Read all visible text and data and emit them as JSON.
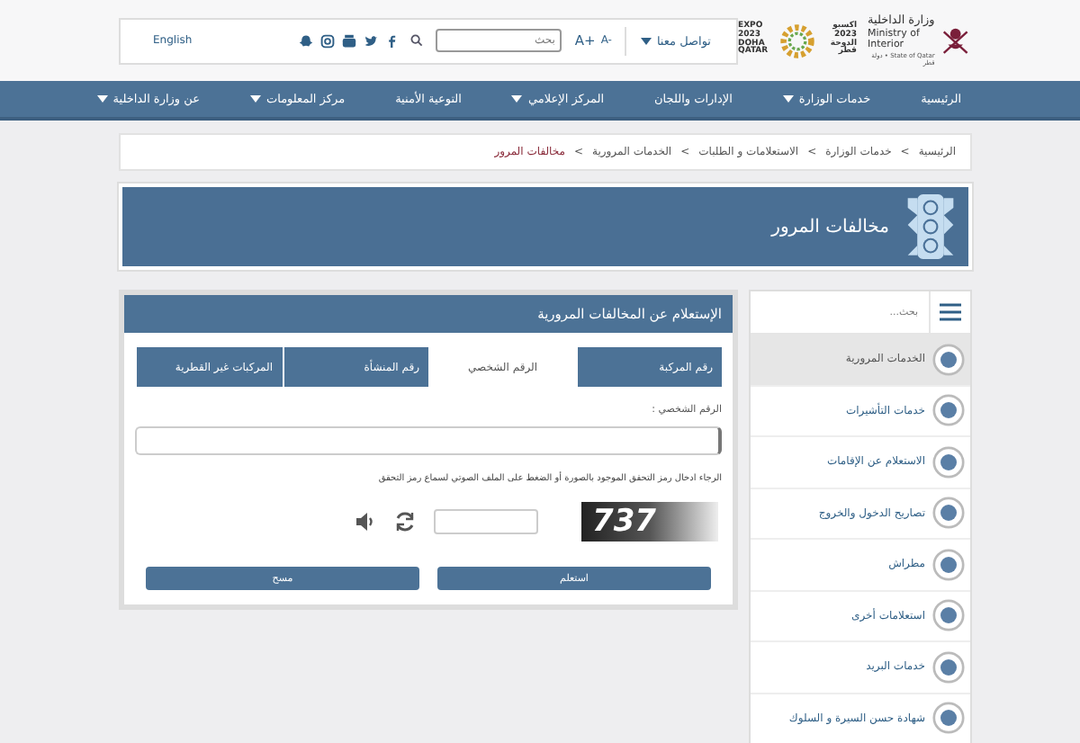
{
  "header": {
    "language_link": "English",
    "search": {
      "placeholder": "بحث"
    },
    "font_decrease": "A-",
    "font_increase": "A+",
    "contact": "تواصل معنا",
    "ministry_ar": "وزارة الداخلية",
    "ministry_en": "Ministry of Interior",
    "state": "State of Qatar • دولة قطر",
    "expo_en": "EXPO 2023 DOHA QATAR",
    "expo_ar": "اكسبو 2023 الدوحة قطر"
  },
  "nav": [
    {
      "label": "الرئيسية",
      "dropdown": false
    },
    {
      "label": "خدمات الوزارة",
      "dropdown": true
    },
    {
      "label": "الإدارات واللجان",
      "dropdown": false
    },
    {
      "label": "المركز الإعلامي",
      "dropdown": true
    },
    {
      "label": "التوعية الأمنية",
      "dropdown": false
    },
    {
      "label": "مركز المعلومات",
      "dropdown": true
    },
    {
      "label": "عن وزارة الداخلية",
      "dropdown": true
    }
  ],
  "breadcrumb": [
    {
      "label": "الرئيسية",
      "current": false
    },
    {
      "label": "خدمات الوزارة",
      "current": false
    },
    {
      "label": "الاستعلامات و الطلبات",
      "current": false
    },
    {
      "label": "الخدمات المرورية",
      "current": false
    },
    {
      "label": "مخالفات المرور",
      "current": true
    }
  ],
  "breadcrumb_separator": ">",
  "page_title": "مخالفات المرور",
  "form": {
    "title": "الإستعلام عن المخالفات المرورية",
    "tabs": [
      {
        "label": "رقم المركبة",
        "selected": false
      },
      {
        "label": "الرقم الشخصي",
        "selected": true
      },
      {
        "label": "رقم المنشأة",
        "selected": false
      },
      {
        "label": "المركبات غير القطرية",
        "selected": false
      }
    ],
    "field_label": "الرقم الشخصي :",
    "captcha_hint": "الرجاء ادخال رمز التحقق الموجود بالصورة أو الضغط على الملف الصوتي لسماع رمز التحقق",
    "captcha_text": "737",
    "buttons": [
      "استعلم",
      "مسح"
    ]
  },
  "sidebar": {
    "search": {
      "placeholder": "بحث..."
    },
    "items": [
      {
        "label": "الخدمات المرورية",
        "selected": true
      },
      {
        "label": "خدمات التأشيرات",
        "selected": false
      },
      {
        "label": "الاستعلام عن الإقامات",
        "selected": false
      },
      {
        "label": "تصاريح الدخول والخروج",
        "selected": false
      },
      {
        "label": "مطراش",
        "selected": false
      },
      {
        "label": "استعلامات أخرى",
        "selected": false
      },
      {
        "label": "خدمات البريد",
        "selected": false
      },
      {
        "label": "شهادة حسن السيرة و السلوك",
        "selected": false
      }
    ]
  }
}
